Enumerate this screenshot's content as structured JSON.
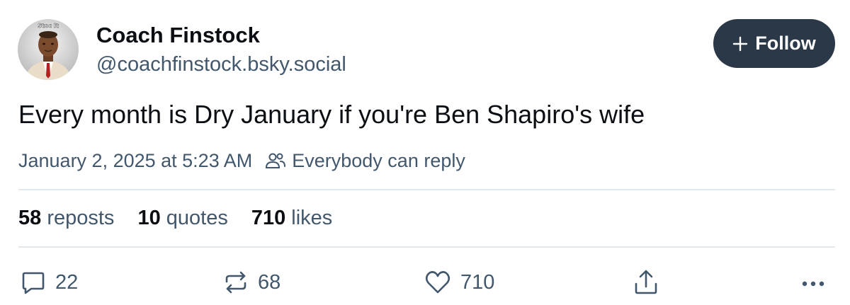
{
  "author": {
    "name": "Coach Finstock",
    "handle": "@coachfinstock.bsky.social",
    "avatar_badge": "Stoc It"
  },
  "follow_button": {
    "label": "Follow",
    "icon": "plus-icon"
  },
  "post": {
    "text": "Every month is Dry January if you're Ben Shapiro's wife",
    "timestamp": "January 2, 2025 at 5:23 AM",
    "reply_setting": "Everybody can reply"
  },
  "stats": [
    {
      "count": "58",
      "label": "reposts"
    },
    {
      "count": "10",
      "label": "quotes"
    },
    {
      "count": "710",
      "label": "likes"
    }
  ],
  "actions": {
    "reply": {
      "icon": "reply-icon",
      "count": "22"
    },
    "repost": {
      "icon": "repost-icon",
      "count": "68"
    },
    "like": {
      "icon": "heart-icon",
      "count": "710"
    },
    "share": {
      "icon": "share-icon"
    },
    "more": {
      "icon": "more-icon"
    }
  },
  "colors": {
    "text": "#0b0f14",
    "muted": "#42576c",
    "button": "#2b3847",
    "divider": "#e3e8ed"
  }
}
